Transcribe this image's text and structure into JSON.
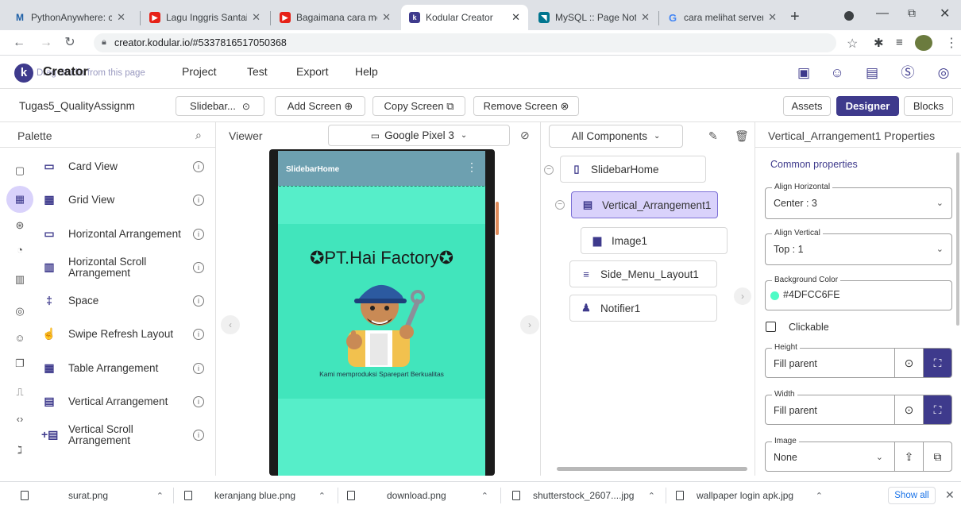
{
  "browser": {
    "tabs": [
      {
        "title": "PythonAnywhere: cont",
        "fav": "M",
        "color": "#1d5fa6"
      },
      {
        "title": "Lagu Inggris Santai Te",
        "fav": "▶",
        "color": "#e62117"
      },
      {
        "title": "Bagaimana cara memb",
        "fav": "▶",
        "color": "#e62117"
      },
      {
        "title": "Kodular Creator",
        "fav": "k",
        "color": "#3e3a8c"
      },
      {
        "title": "MySQL :: Page Not Fou",
        "fav": "◥",
        "color": "#00758f"
      },
      {
        "title": "cara melihat server ko",
        "fav": "G",
        "color": "#4285f4"
      }
    ],
    "new_tab": "+",
    "url": "creator.kodular.io/#5337816517050368"
  },
  "app": {
    "logo_text": "Creator",
    "logo_overlay": "Drag Studio from this page",
    "menu": [
      "Project",
      "Test",
      "Export",
      "Help"
    ],
    "header_icons": [
      "folder-icon",
      "palette-icon",
      "notes-icon",
      "dollar-icon",
      "account-icon"
    ]
  },
  "project": {
    "name": "Tugas5_QualityAssignm",
    "screen_select": "Slidebar...",
    "add_screen": "Add Screen ⊕",
    "copy_screen": "Copy Screen ⧉",
    "remove_screen": "Remove Screen ⊗",
    "assets": "Assets",
    "designer": "Designer",
    "blocks": "Blocks"
  },
  "palette": {
    "title": "Palette",
    "categories": [
      "user-interface-icon",
      "layout-icon",
      "media-icon",
      "drawing-icon",
      "maps-icon",
      "sensors-icon",
      "social-icon",
      "storage-icon",
      "connectivity-icon",
      "extensions-icon",
      "rss-icon"
    ],
    "items": [
      {
        "label": "Card View",
        "icon": "card-view-icon",
        "glyph": "▭"
      },
      {
        "label": "Grid View",
        "icon": "grid-view-icon",
        "glyph": "▦"
      },
      {
        "label": "Horizontal Arrangement",
        "icon": "horizontal-arrangement-icon",
        "glyph": "▭"
      },
      {
        "label": "Horizontal Scroll Arrangement",
        "icon": "horizontal-scroll-arrangement-icon",
        "glyph": "▥"
      },
      {
        "label": "Space",
        "icon": "space-icon",
        "glyph": "‡"
      },
      {
        "label": "Swipe Refresh Layout",
        "icon": "swipe-refresh-icon",
        "glyph": "☝"
      },
      {
        "label": "Table Arrangement",
        "icon": "table-arrangement-icon",
        "glyph": "▦"
      },
      {
        "label": "Vertical Arrangement",
        "icon": "vertical-arrangement-icon",
        "glyph": "▤"
      },
      {
        "label": "Vertical Scroll Arrangement",
        "icon": "vertical-scroll-arrangement-icon",
        "glyph": "+▤"
      }
    ]
  },
  "viewer": {
    "title": "Viewer",
    "device": "Google Pixel 3",
    "screen_title": "SlidebarHome",
    "heading": "✪PT.Hai Factory✪",
    "caption": "Kami memproduksi Sparepart Berkualitas"
  },
  "components": {
    "filter": "All Components",
    "tree": [
      {
        "label": "SlidebarHome",
        "icon": "screen-icon"
      },
      {
        "label": "Vertical_Arrangement1",
        "icon": "vertical-arrangement-icon"
      },
      {
        "label": "Image1",
        "icon": "image-icon"
      },
      {
        "label": "Side_Menu_Layout1",
        "icon": "list-icon"
      },
      {
        "label": "Notifier1",
        "icon": "bell-icon"
      }
    ]
  },
  "properties": {
    "title": "Vertical_Arrangement1 Properties",
    "section": "Common properties",
    "align_horizontal": {
      "label": "Align Horizontal",
      "value": "Center : 3"
    },
    "align_vertical": {
      "label": "Align Vertical",
      "value": "Top : 1"
    },
    "background_color": {
      "label": "Background Color",
      "value": "#4DFCC6FE",
      "swatch": "#4dfcc6"
    },
    "clickable": {
      "label": "Clickable",
      "checked": false
    },
    "height": {
      "label": "Height",
      "value": "Fill parent"
    },
    "width": {
      "label": "Width",
      "value": "Fill parent"
    },
    "image": {
      "label": "Image",
      "value": "None"
    }
  },
  "downloads": {
    "items": [
      "surat.png",
      "keranjang blue.png",
      "download.png",
      "shutterstock_2607....jpg",
      "wallpaper login apk.jpg"
    ],
    "show_all": "Show all"
  },
  "colors": {
    "accent": "#3e3a8c",
    "selected_node": "#d9d2fb"
  }
}
